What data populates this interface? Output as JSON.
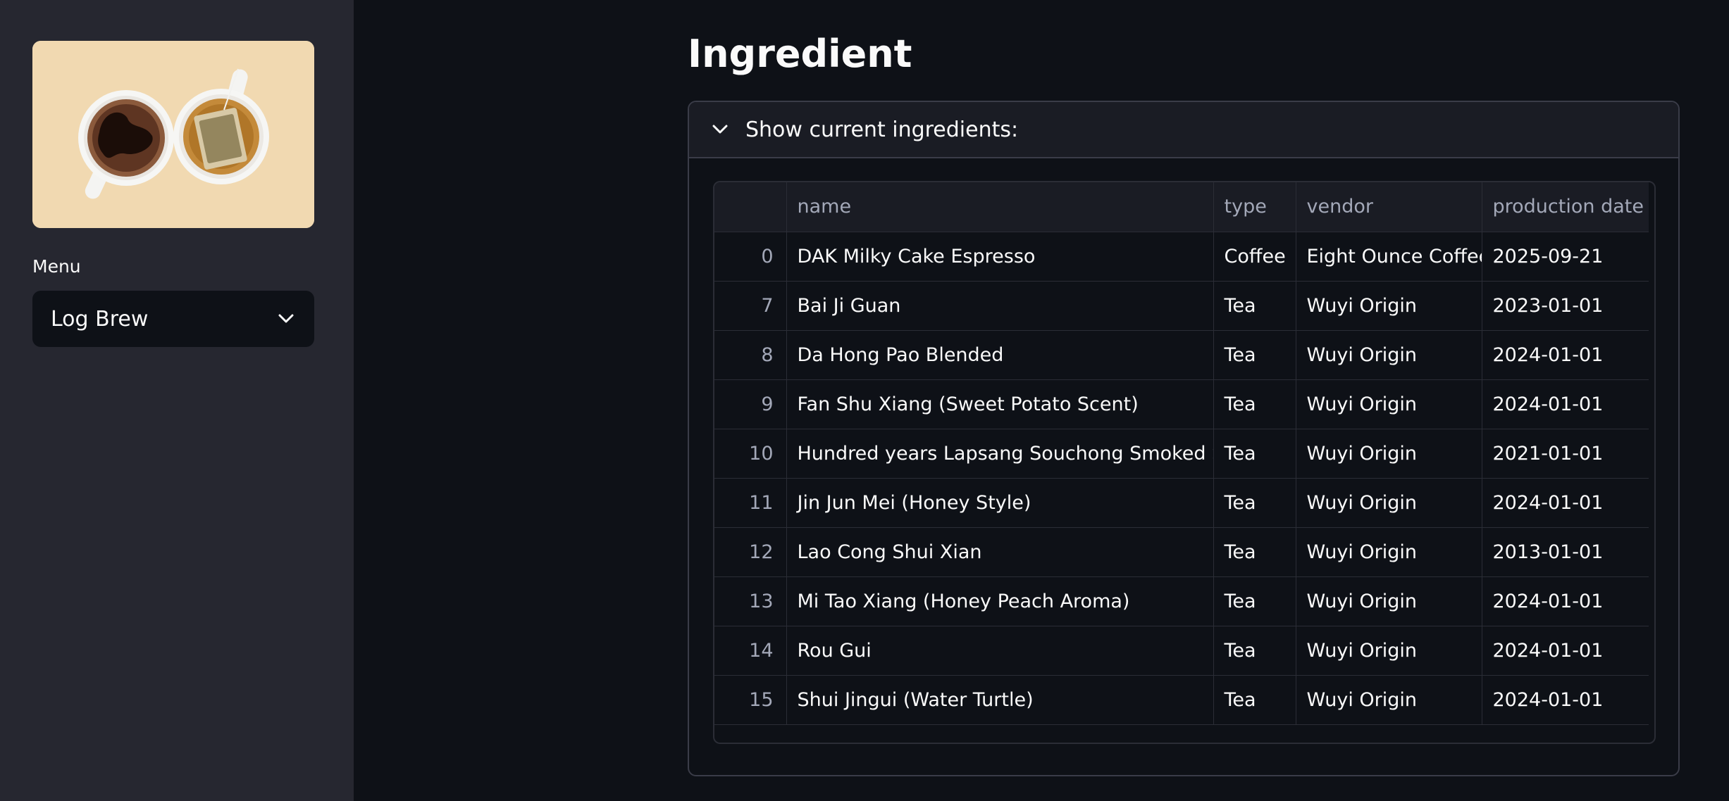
{
  "sidebar": {
    "image_label": "coffee and tea cups",
    "menu_label": "Menu",
    "menu_selected": "Log Brew"
  },
  "main": {
    "title": "Ingredient",
    "expander_label": "Show current ingredients:",
    "table": {
      "columns": [
        "",
        "name",
        "type",
        "vendor",
        "production date"
      ],
      "rows": [
        {
          "index": "0",
          "name": "DAK Milky Cake Espresso",
          "type": "Coffee",
          "vendor": "Eight Ounce Coffee",
          "date": "2025-09-21"
        },
        {
          "index": "7",
          "name": "Bai Ji Guan",
          "type": "Tea",
          "vendor": "Wuyi Origin",
          "date": "2023-01-01"
        },
        {
          "index": "8",
          "name": "Da Hong Pao Blended",
          "type": "Tea",
          "vendor": "Wuyi Origin",
          "date": "2024-01-01"
        },
        {
          "index": "9",
          "name": "Fan Shu Xiang (Sweet Potato Scent)",
          "type": "Tea",
          "vendor": "Wuyi Origin",
          "date": "2024-01-01"
        },
        {
          "index": "10",
          "name": "Hundred years Lapsang Souchong Smoked Style",
          "type": "Tea",
          "vendor": "Wuyi Origin",
          "date": "2021-01-01"
        },
        {
          "index": "11",
          "name": "Jin Jun Mei (Honey Style)",
          "type": "Tea",
          "vendor": "Wuyi Origin",
          "date": "2024-01-01"
        },
        {
          "index": "12",
          "name": "Lao Cong Shui Xian",
          "type": "Tea",
          "vendor": "Wuyi Origin",
          "date": "2013-01-01"
        },
        {
          "index": "13",
          "name": "Mi Tao Xiang (Honey Peach Aroma)",
          "type": "Tea",
          "vendor": "Wuyi Origin",
          "date": "2024-01-01"
        },
        {
          "index": "14",
          "name": "Rou Gui",
          "type": "Tea",
          "vendor": "Wuyi Origin",
          "date": "2024-01-01"
        },
        {
          "index": "15",
          "name": "Shui Jingui (Water Turtle)",
          "type": "Tea",
          "vendor": "Wuyi Origin",
          "date": "2024-01-01"
        }
      ]
    }
  },
  "icons": {
    "select_chevron": "chevron-down-icon",
    "expander_chevron": "chevron-down-icon"
  },
  "colors": {
    "app_bg": "#0e1117",
    "sidebar_bg": "#262730",
    "header_bg": "#1a1c24",
    "border": "#3a3c48",
    "text": "#fafafa",
    "muted_text": "#a3a8b8"
  }
}
